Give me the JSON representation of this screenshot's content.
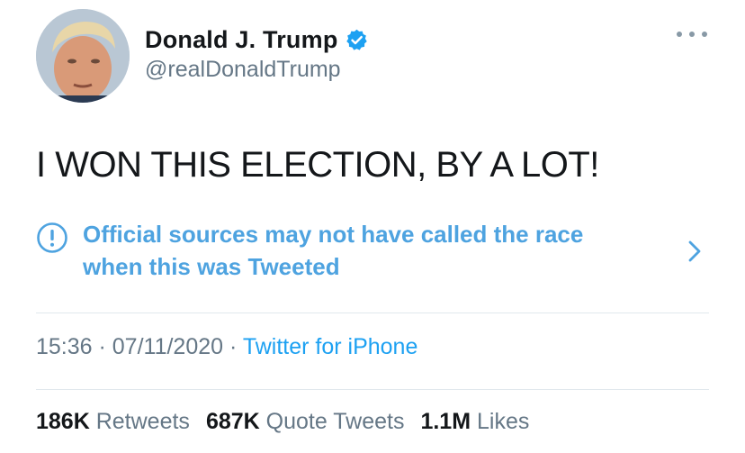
{
  "user": {
    "display_name": "Donald J. Trump",
    "handle": "@realDonaldTrump",
    "verified_icon": "verified-badge-icon",
    "avatar_icon": "profile-photo"
  },
  "tweet": {
    "text": "I WON THIS ELECTION, BY A LOT!"
  },
  "notice": {
    "line1": "Official sources may not have called the race",
    "line2": "when this was Tweeted",
    "icon": "exclamation-circle-icon",
    "chevron": "chevron-right-icon"
  },
  "meta": {
    "time": "15:36",
    "separator1": " · ",
    "date": "07/11/2020",
    "separator2": " · ",
    "source": "Twitter for iPhone"
  },
  "stats": {
    "retweets_count": "186K",
    "retweets_label": "Retweets",
    "quotes_count": "687K",
    "quotes_label": "Quote Tweets",
    "likes_count": "1.1M",
    "likes_label": "Likes"
  },
  "colors": {
    "link": "#1da1f2",
    "notice": "#4ea3e0",
    "secondary_text": "#657786",
    "primary_text": "#14171a",
    "divider": "#e1e8ed"
  }
}
